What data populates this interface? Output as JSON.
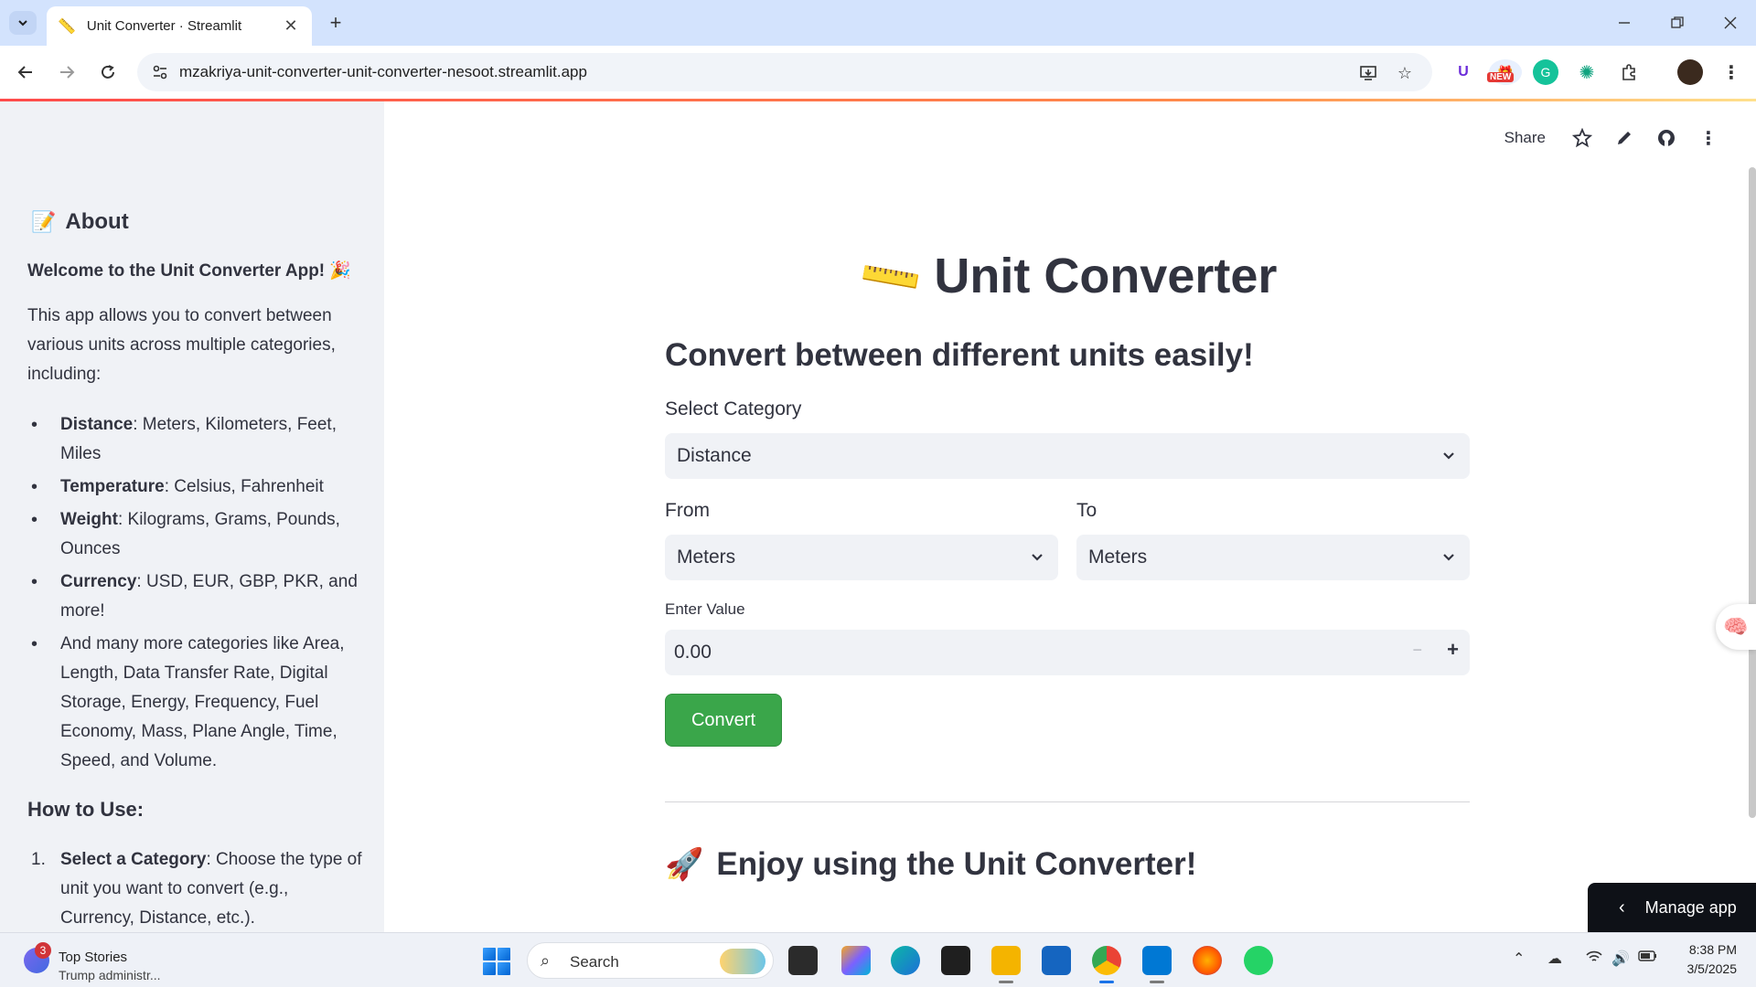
{
  "browser": {
    "tab_title": "Unit Converter · Streamlit",
    "url": "mzakriya-unit-converter-unit-converter-nesoot.streamlit.app",
    "ext_new_badge": "NEW"
  },
  "app_header": {
    "share_label": "Share"
  },
  "sidebar": {
    "about_emoji": "📝",
    "about_title": "About",
    "welcome": "Welcome to the Unit Converter App! 🎉",
    "intro": "This app allows you to convert between various units across multiple categories, including:",
    "categories": [
      {
        "name": "Distance",
        "units": ": Meters, Kilometers, Feet, Miles"
      },
      {
        "name": "Temperature",
        "units": ": Celsius, Fahrenheit"
      },
      {
        "name": "Weight",
        "units": ": Kilograms, Grams, Pounds, Ounces"
      },
      {
        "name": "Currency",
        "units": ": USD, EUR, GBP, PKR, and more!"
      },
      {
        "name": "",
        "units": "And many more categories like Area, Length, Data Transfer Rate, Digital Storage, Energy, Frequency, Fuel Economy, Mass, Plane Angle, Time, Speed, and Volume."
      }
    ],
    "howto_title": "How to Use:",
    "steps": [
      {
        "num": "1.",
        "name": "Select a Category",
        "text": ": Choose the type of unit you want to convert (e.g., Currency, Distance, etc.)."
      }
    ]
  },
  "main": {
    "title_emoji": "📏",
    "title": "Unit Converter",
    "subtitle": "Convert between different units easily!",
    "category_label": "Select Category",
    "category_value": "Distance",
    "from_label": "From",
    "from_value": "Meters",
    "to_label": "To",
    "to_value": "Meters",
    "value_label": "Enter Value",
    "value": "0.00",
    "convert_label": "Convert",
    "enjoy_emoji": "🚀",
    "enjoy_text": "Enjoy using the Unit Converter!"
  },
  "manage_app": {
    "label": "Manage app"
  },
  "taskbar": {
    "news_badge": "3",
    "news_title": "Top Stories",
    "news_sub": "Trump administr...",
    "search_placeholder": "Search",
    "time": "8:38 PM",
    "date": "3/5/2025"
  }
}
